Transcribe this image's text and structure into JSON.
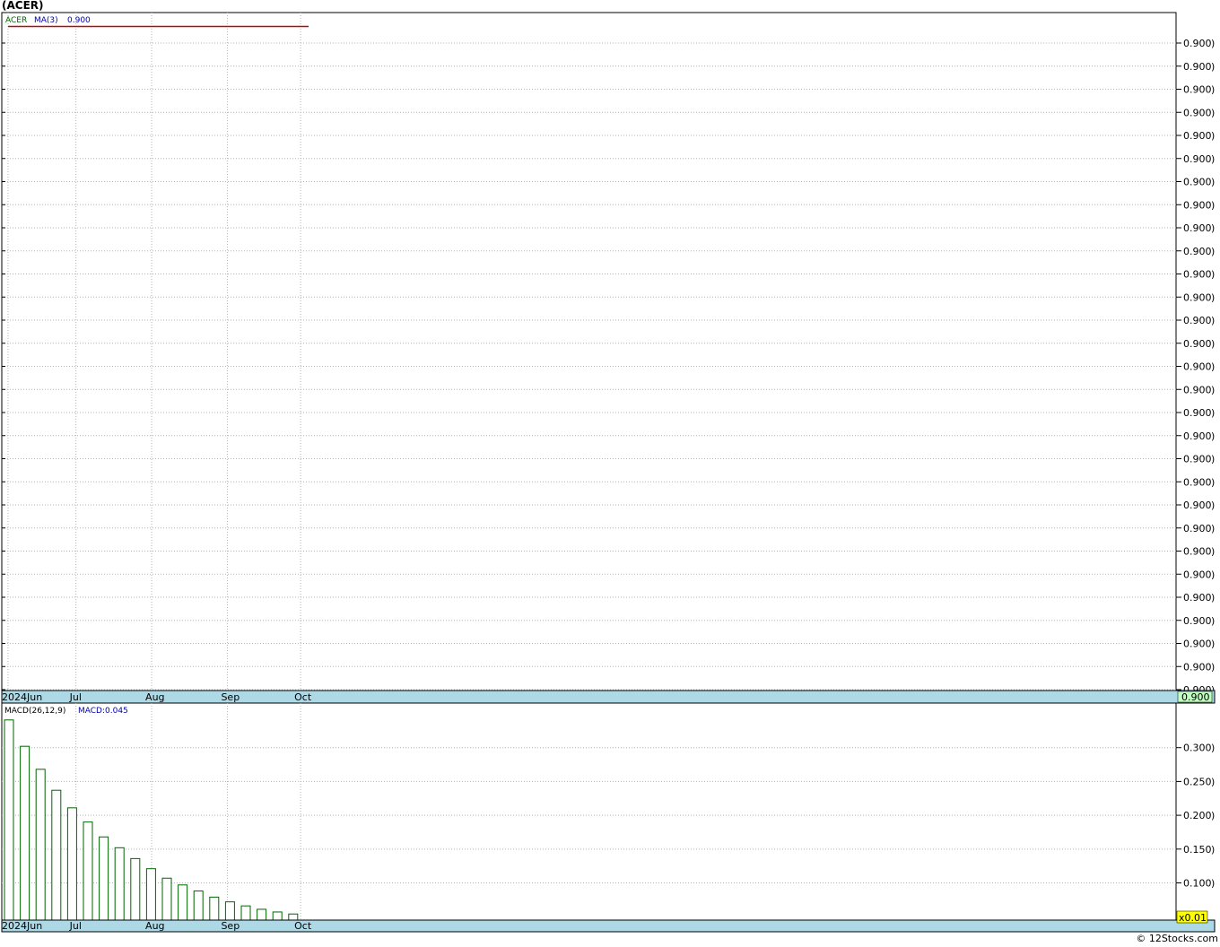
{
  "header": {
    "title": "(ACER)"
  },
  "footer": {
    "copyright": "© 12Stocks.com"
  },
  "colors": {
    "price_line": "#cc0000",
    "legend_symbol": "#006600",
    "legend_value": "#0000aa",
    "macd_bar": "#006600",
    "axis_band": "#add8e6",
    "last_price_badge": "#bfffbf",
    "multiplier_badge": "#ffff00",
    "grid": "#b4b4b4"
  },
  "chart_data": [
    {
      "type": "line",
      "panel": "price",
      "legend": {
        "symbol": "ACER",
        "ma_label": "MA(3)",
        "ma_value": "0.900"
      },
      "x_ticks": [
        "2024Jun",
        "Jul",
        "Aug",
        "Sep",
        "Oct"
      ],
      "x_tick_days": [
        0,
        30,
        61,
        92,
        122
      ],
      "x_range_days": [
        0,
        126
      ],
      "y_tick_labels": [
        "0.900",
        "0.900",
        "0.900",
        "0.900",
        "0.900",
        "0.900",
        "0.900",
        "0.900",
        "0.900",
        "0.900",
        "0.900",
        "0.900",
        "0.900",
        "0.900",
        "0.900",
        "0.900",
        "0.900",
        "0.900",
        "0.900",
        "0.900",
        "0.900",
        "0.900",
        "0.900",
        "0.900",
        "0.900",
        "0.900",
        "0.900",
        "0.900",
        "0.900",
        "0.900"
      ],
      "last_price_label": "0.900",
      "series": [
        {
          "values": [
            0.9,
            0.9
          ]
        }
      ],
      "ylim": [
        0.9,
        0.9
      ],
      "grid": true
    },
    {
      "type": "bar",
      "panel": "macd",
      "legend": {
        "label": "MACD(26,12,9)",
        "value_label": "MACD:0.045"
      },
      "x_ticks": [
        "2024Jun",
        "Jul",
        "Aug",
        "Sep",
        "Oct"
      ],
      "y_ticks": [
        0.3,
        0.25,
        0.2,
        0.15,
        0.1
      ],
      "y_tick_labels": [
        "0.300",
        "0.250",
        "0.200",
        "0.150",
        "0.100"
      ],
      "ylim": [
        0.045,
        0.35
      ],
      "multiplier_label": "x0.01",
      "values": [
        0.341,
        0.302,
        0.268,
        0.237,
        0.211,
        0.19,
        0.168,
        0.152,
        0.136,
        0.121,
        0.107,
        0.097,
        0.088,
        0.079,
        0.072,
        0.066,
        0.061,
        0.057,
        0.054
      ],
      "grid": true
    }
  ]
}
